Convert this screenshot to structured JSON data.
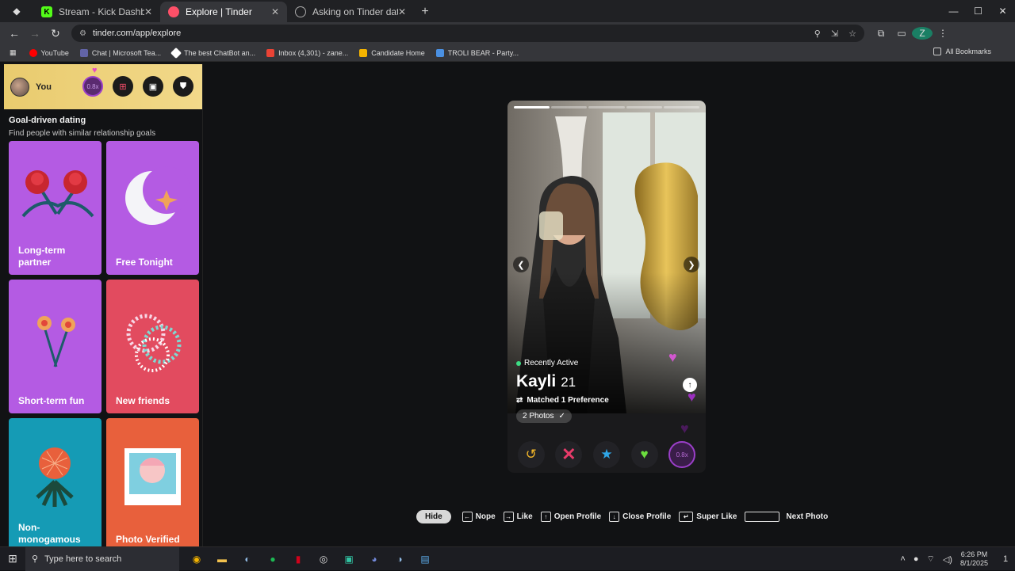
{
  "browser": {
    "tabs": [
      {
        "label": "Stream - Kick Dashboard",
        "fav_color": "#53fc18",
        "fav_text": "K"
      },
      {
        "label": "Explore | Tinder",
        "fav_color": "#fd5068",
        "fav_text": ""
      },
      {
        "label": "Asking on Tinder date",
        "fav_color": "#444",
        "fav_text": ""
      }
    ],
    "new_tab": "+",
    "url": "tinder.com/app/explore",
    "bookmarks": [
      {
        "label": "YouTube",
        "color": "#ff0000"
      },
      {
        "label": "Chat | Microsoft Tea...",
        "color": "#6264a7"
      },
      {
        "label": "The best ChatBot an...",
        "color": "#ffffff"
      },
      {
        "label": "Inbox (4,301) - zane...",
        "color": "#ea4335"
      },
      {
        "label": "Candidate Home",
        "color": "#f4b400"
      },
      {
        "label": "TROLI BEAR - Party...",
        "color": "#4a90e2"
      }
    ],
    "all_bookmarks": "All Bookmarks",
    "profile_initial": "Z"
  },
  "sidebar": {
    "user_label": "You",
    "boost_label": "0.8x",
    "section_title": "Goal-driven dating",
    "section_subtitle": "Find people with similar relationship goals",
    "cards": [
      {
        "label": "Long-term partner",
        "color": "#b45be3"
      },
      {
        "label": "Free Tonight",
        "color": "#b45be3"
      },
      {
        "label": "Short-term fun",
        "color": "#b45be3"
      },
      {
        "label": "New friends",
        "color": "#e24b5f"
      },
      {
        "label": "Non-monogamous",
        "color": "#159bb5"
      },
      {
        "label": "Photo Verified",
        "color": "#e8603c"
      }
    ]
  },
  "profile": {
    "status": "Recently Active",
    "name": "Kayli",
    "age": "21",
    "matched": "Matched 1 Preference",
    "photos": "2 Photos",
    "photo_count": 5,
    "photo_index": 0,
    "boost_label": "0.8x"
  },
  "shortcuts": {
    "hide": "Hide",
    "nope": "Nope",
    "like": "Like",
    "open_profile": "Open Profile",
    "close_profile": "Close Profile",
    "super_like": "Super Like",
    "next_photo": "Next Photo"
  },
  "taskbar": {
    "search_placeholder": "Type here to search",
    "time": "6:26 PM",
    "date": "8/1/2025",
    "notifications": "1"
  }
}
